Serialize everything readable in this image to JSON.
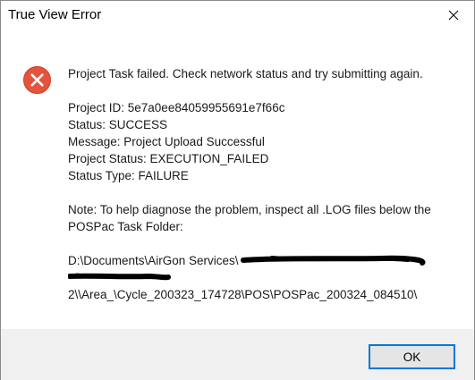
{
  "window": {
    "title": "True View Error"
  },
  "message": {
    "headline": "Project Task failed.  Check network status and try submitting again.",
    "project_id": "Project ID: 5e7a0ee84059955691e7f66c",
    "status": "Status: SUCCESS",
    "message_line": "Message: Project Upload Successful",
    "project_status": "Project Status: EXECUTION_FAILED",
    "status_type": "Status Type: FAILURE",
    "note_line1": "Note: To help diagnose the problem, inspect all .LOG files below the",
    "note_line2": "POSPac Task Folder:",
    "path_line1": "D:\\Documents\\AirGon Services\\",
    "path_line3": "2\\\\Area_\\Cycle_200323_174728\\POS\\POSPac_200324_084510\\"
  },
  "buttons": {
    "ok_label": "OK"
  },
  "icons": {
    "error": "error-icon",
    "close": "close-icon"
  },
  "colors": {
    "error_red": "#e81123",
    "accent": "#0078d7",
    "footer_bg": "#f0f0f0"
  }
}
